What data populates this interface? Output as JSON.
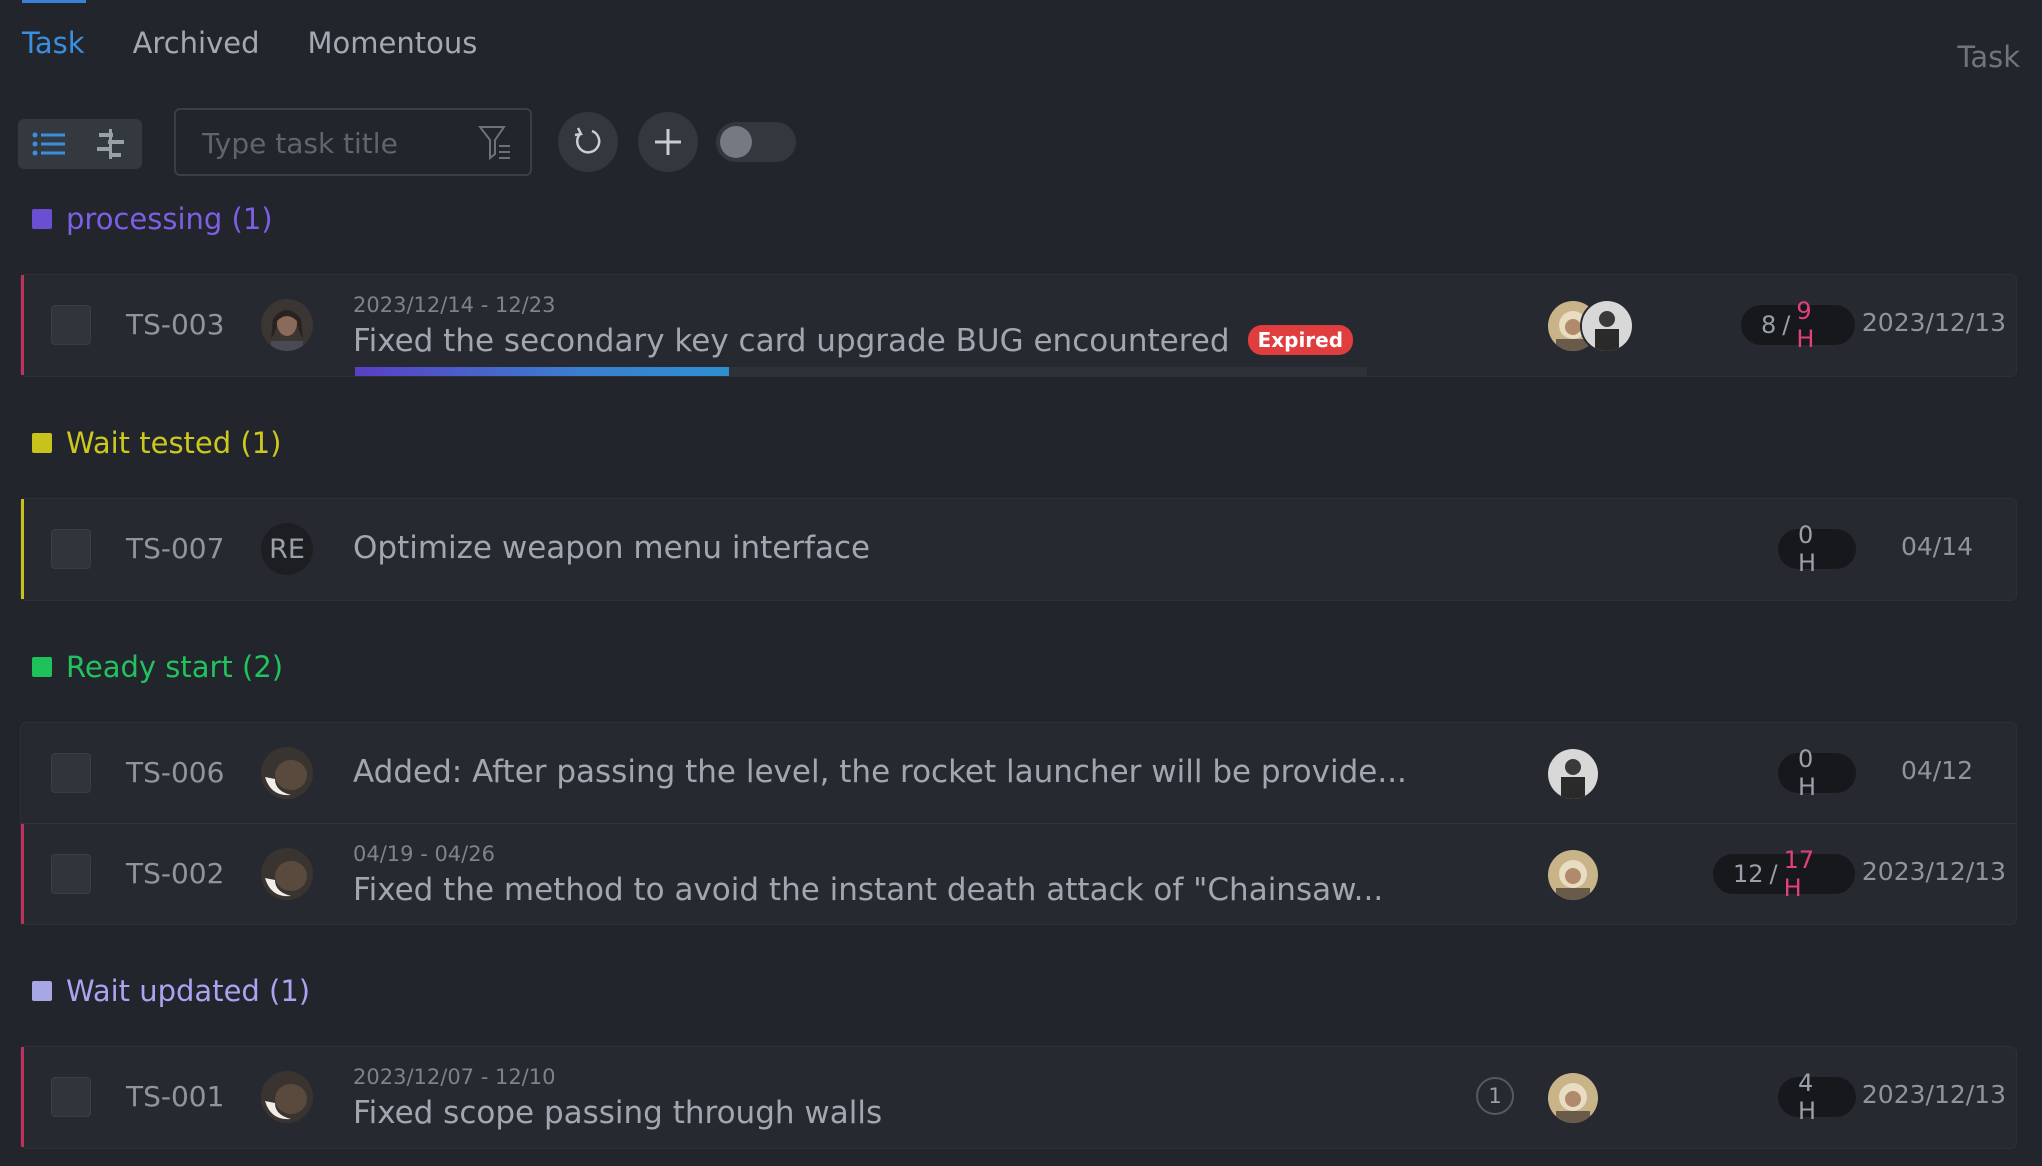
{
  "tabs": [
    {
      "label": "Task",
      "active": true
    },
    {
      "label": "Archived",
      "active": false
    },
    {
      "label": "Momentous",
      "active": false
    }
  ],
  "page_label": "Task",
  "toolbar": {
    "search_placeholder": "Type task title",
    "icons": [
      "list-view-icon",
      "gantt-view-icon",
      "filter-icon",
      "refresh-icon",
      "plus-icon"
    ],
    "toggle_on": false
  },
  "groups": [
    {
      "name": "processing (1)",
      "color": "#6b4fd3",
      "tasks": [
        {
          "id": "TS-003",
          "date_range": "2023/12/14 - 12/23",
          "title": "Fixed the secondary key card upgrade BUG encountered",
          "badge": "Expired",
          "progress": 0.37,
          "hours_used": "8",
          "hours_sep": "/",
          "hours_total": "9 H",
          "due": "2023/12/13",
          "bar_color": "#c0325c"
        }
      ]
    },
    {
      "name": "Wait tested (1)",
      "color": "#c7c21c",
      "tasks": [
        {
          "id": "TS-007",
          "avatar_initials": "RE",
          "title": "Optimize weapon menu interface",
          "hours": "0 H",
          "due": "04/14",
          "bar_color": "#c7c21c"
        }
      ]
    },
    {
      "name": "Ready start (2)",
      "color": "#1fc25a",
      "tasks": [
        {
          "id": "TS-006",
          "title": "Added: After passing the level, the rocket launcher will be provide...",
          "hours": "0 H",
          "due": "04/12",
          "bar_color": ""
        },
        {
          "id": "TS-002",
          "date_range": "04/19 - 04/26",
          "title": "Fixed the method to avoid the instant death attack of \"Chainsaw...",
          "hours_used": "12",
          "hours_sep": "/",
          "hours_total": "17 H",
          "due": "2023/12/13",
          "bar_color": "#c0325c"
        }
      ]
    },
    {
      "name": "Wait updated (1)",
      "color": "#a9a6e6",
      "tasks": [
        {
          "id": "TS-001",
          "date_range": "2023/12/07 - 12/10",
          "title": "Fixed scope passing through walls",
          "comment_count": "1",
          "hours": "4 H",
          "due": "2023/12/13",
          "bar_color": "#c0325c"
        }
      ]
    }
  ]
}
